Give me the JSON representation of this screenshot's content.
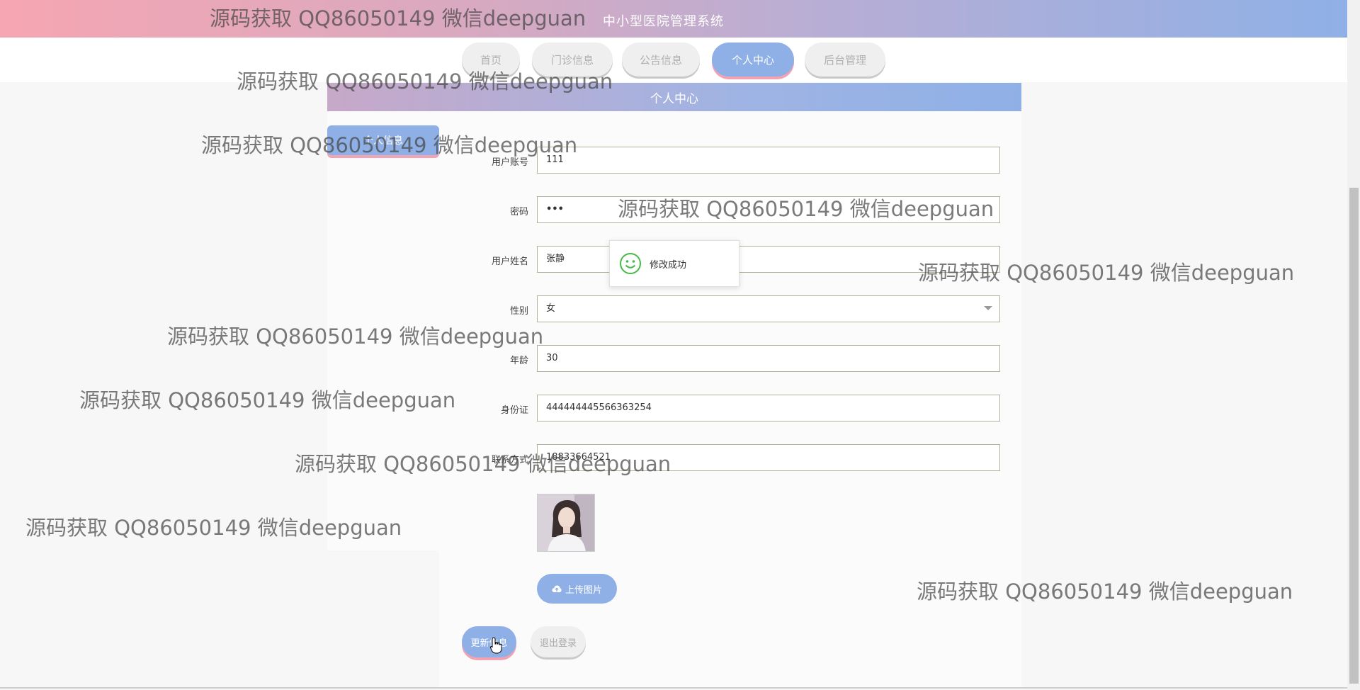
{
  "header": {
    "title": "中小型医院管理系统"
  },
  "nav": {
    "items": [
      {
        "label": "首页"
      },
      {
        "label": "门诊信息"
      },
      {
        "label": "公告信息"
      },
      {
        "label": "个人中心"
      },
      {
        "label": "后台管理"
      }
    ],
    "active": "个人中心"
  },
  "panel": {
    "title": "个人中心",
    "side_tab": "个人信息"
  },
  "form": {
    "account": {
      "label": "用户账号",
      "value": "111"
    },
    "password": {
      "label": "密码",
      "value": "•••"
    },
    "name": {
      "label": "用户姓名",
      "value": "张静"
    },
    "gender": {
      "label": "性别",
      "value": "女"
    },
    "age": {
      "label": "年龄",
      "value": "30"
    },
    "id_card": {
      "label": "身份证",
      "value": "444444445566363254"
    },
    "phone": {
      "label": "联系方式",
      "value": "18833664521"
    },
    "upload_label": "上传图片",
    "update_label": "更新信息",
    "logout_label": "退出登录"
  },
  "toast": {
    "message": "修改成功"
  },
  "watermark": {
    "text": "源码获取 QQ86050149 微信deepguan"
  },
  "colors": {
    "accent": "#8fb0e6",
    "pink": "#f1a3b4",
    "success": "#44bb44"
  }
}
